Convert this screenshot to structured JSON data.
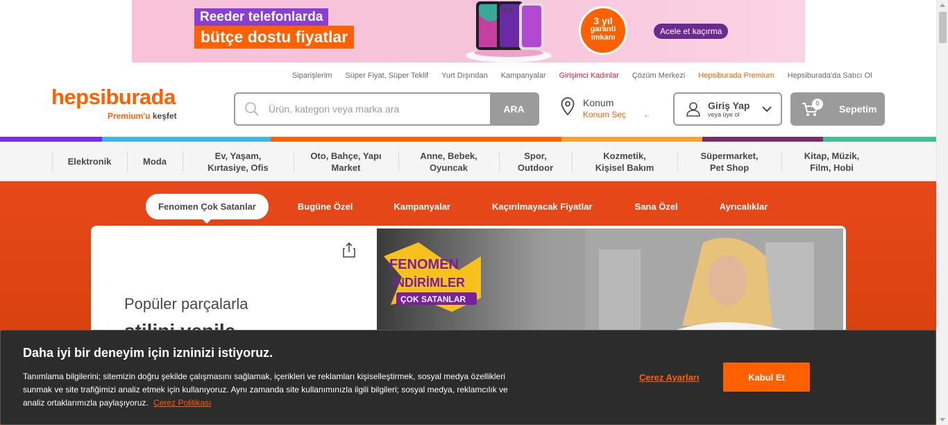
{
  "banner": {
    "line1": "Reeder telefonlarda",
    "line2": "bütçe dostu fiyatlar",
    "badge_top": "3 yıl",
    "badge_mid": "garanti",
    "badge_bot": "imkanı",
    "cta": "Acele et kaçırma"
  },
  "utility_links": [
    "Siparişlerim",
    "Süper Fiyat, Süper Teklif",
    "Yurt Dışından",
    "Kampanyalar",
    "Girişimci Kadınlar",
    "Çözüm Merkezi",
    "Hepsiburada Premium",
    "Hepsiburada'da Satıcı Ol"
  ],
  "logo": {
    "word": "hepsiburada",
    "premium": "Premium'u",
    "kesfet": " keşfet"
  },
  "search": {
    "placeholder": "Ürün, kategori veya marka ara",
    "button": "ARA"
  },
  "location": {
    "title": "Konum",
    "select": "Konum Seç"
  },
  "account": {
    "title": "Giriş Yap",
    "subtitle": "veya üye ol"
  },
  "cart": {
    "count": "0",
    "label": "Sepetim"
  },
  "stripe_colors": [
    "#7d2ae8",
    "#3bb6e8",
    "#ff6000",
    "#ff6000",
    "#f9a233",
    "#7b2d64",
    "#3dc195"
  ],
  "categories": [
    {
      "l1": "Elektronik",
      "l2": ""
    },
    {
      "l1": "Moda",
      "l2": ""
    },
    {
      "l1": "Ev, Yaşam,",
      "l2": "Kırtasiye, Ofis"
    },
    {
      "l1": "Oto, Bahçe, Yapı",
      "l2": "Market"
    },
    {
      "l1": "Anne, Bebek,",
      "l2": "Oyuncak"
    },
    {
      "l1": "Spor,",
      "l2": "Outdoor"
    },
    {
      "l1": "Kozmetik,",
      "l2": "Kişisel Bakım"
    },
    {
      "l1": "Süpermarket,",
      "l2": "Pet Shop"
    },
    {
      "l1": "Kitap, Müzik,",
      "l2": "Film, Hobi"
    }
  ],
  "hero_tabs": [
    "Fenomen Çok Satanlar",
    "Bugüne Özel",
    "Kampanyalar",
    "Kaçırılmayacak Fiyatlar",
    "Sana Özel",
    "Ayrıcalıklar"
  ],
  "hero_card": {
    "headline": "Popüler parçalarla",
    "headline2": "stilini yenile",
    "promo_1": "FENOMEN",
    "promo_2": "İNDİRİMLER",
    "promo_3": "ÇOK SATANLAR"
  },
  "cookie": {
    "title": "Daha iyi bir deneyim için izninizi istiyoruz.",
    "body": "Tanımlama bilgilerini; sitemizin doğru şekilde çalışmasını sağlamak, içerikleri ve reklamları kişiselleştirmek, sosyal medya özellikleri sunmak ve site trafiğimizi analiz etmek için kullanıyoruz. Aynı zamanda site kullanımınızla ilgili bilgileri; sosyal medya, reklamcılık ve analiz ortaklarımızla paylaşıyoruz.",
    "policy": "Çerez Politikası",
    "settings": "Çerez Ayarları",
    "accept": "Kabul Et"
  }
}
